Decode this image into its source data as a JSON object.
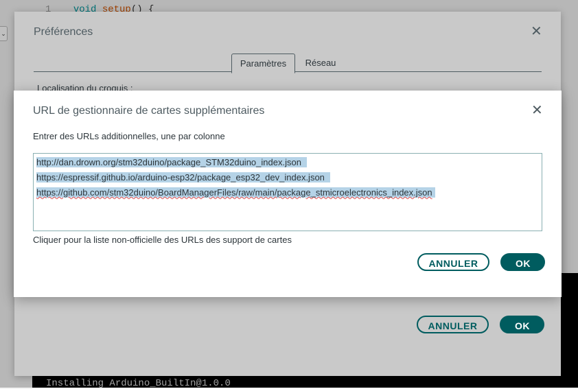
{
  "ide": {
    "line_number": "1",
    "code_keyword": "void",
    "code_function": "setup",
    "code_rest": "() {",
    "dropdown_glyph": "⌄",
    "console_text": "Installing Arduino_BuiltIn@1.0.0"
  },
  "preferences": {
    "title": "Préférences",
    "close_glyph": "✕",
    "tabs": [
      {
        "label": "Paramètres",
        "active": true
      },
      {
        "label": "Réseau",
        "active": false
      }
    ],
    "sketch_location_label": "Localisation du croquis :",
    "cancel_label": "ANNULER",
    "ok_label": "OK"
  },
  "url_dialog": {
    "title": "URL de gestionnaire de cartes supplémentaires",
    "close_glyph": "✕",
    "instructions": "Entrer des URLs additionnelles, une par colonne",
    "urls": [
      "http://dan.drown.org/stm32duino/package_STM32duino_index.json",
      "https://espressif.github.io/arduino-esp32/package_esp32_dev_index.json",
      "https://github.com/stm32duino/BoardManagerFiles/raw/main/package_stmicroelectronics_index.json"
    ],
    "unofficial_link": "Cliquer pour la liste non-officielle des URLs des support de cartes",
    "cancel_label": "ANNULER",
    "ok_label": "OK"
  },
  "colors": {
    "accent": "#005c5f",
    "selection": "#b5d3e7",
    "text": "#2c353a"
  }
}
